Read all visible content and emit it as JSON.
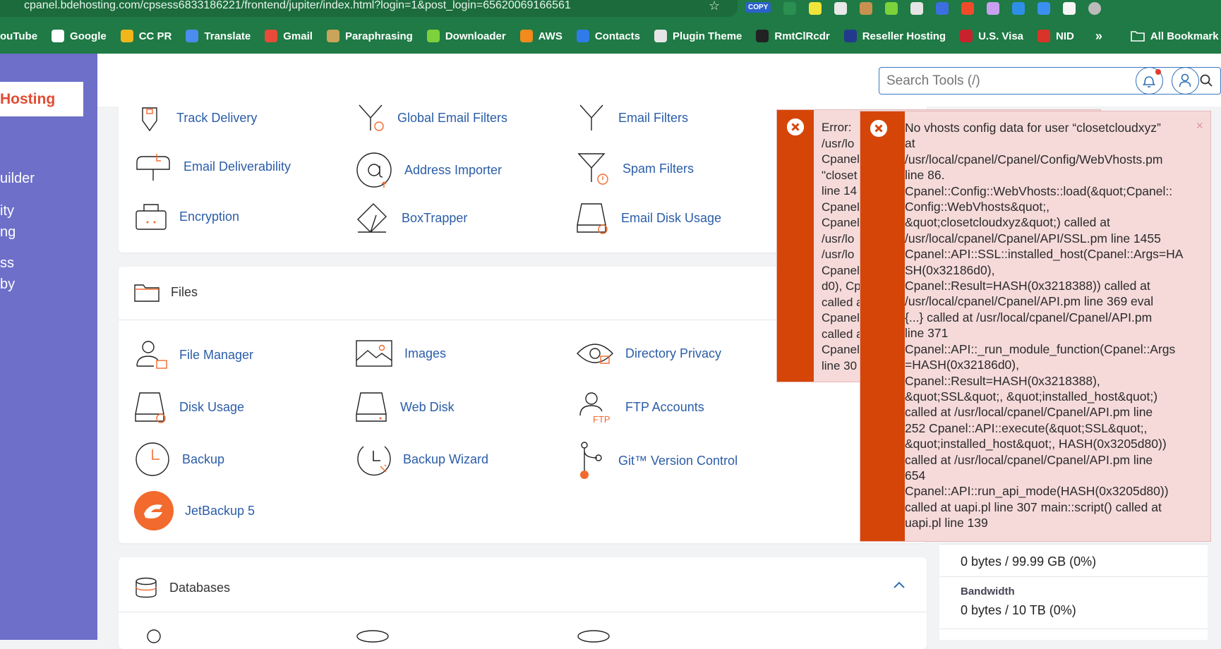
{
  "browser": {
    "url": "cpanel.bdehosting.com/cpsess6833186221/frontend/jupiter/index.html?login=1&post_login=65620069166561",
    "copy_badge": "COPY",
    "bookmarks": [
      {
        "label": "ouTube",
        "color": "#e62117"
      },
      {
        "label": "Google",
        "color": "#ffffff"
      },
      {
        "label": "CC PR",
        "color": "#f2b61b"
      },
      {
        "label": "Translate",
        "color": "#4a8cf0"
      },
      {
        "label": "Gmail",
        "color": "#e84b3a"
      },
      {
        "label": "Paraphrasing",
        "color": "#c9a45a"
      },
      {
        "label": "Downloader",
        "color": "#7dd23b"
      },
      {
        "label": "AWS",
        "color": "#f28a1c"
      },
      {
        "label": "Contacts",
        "color": "#2f7be8"
      },
      {
        "label": "Plugin Theme",
        "color": "#e5e5e5"
      },
      {
        "label": "RmtClRcdr",
        "color": "#222222"
      },
      {
        "label": "Reseller Hosting",
        "color": "#233a8c"
      },
      {
        "label": "U.S. Visa",
        "color": "#c8232c"
      },
      {
        "label": "NID",
        "color": "#d9342a"
      }
    ],
    "more_chevron": "»",
    "all_bookmarks": "All Bookmark"
  },
  "sidebar": {
    "logo_text": "Hosting",
    "items": [
      "uilder",
      "ity",
      "ng",
      "ss",
      "by"
    ]
  },
  "search": {
    "placeholder": "Search Tools (/)"
  },
  "email_tools": [
    "Track Delivery",
    "Global Email Filters",
    "Email Filters",
    "Email Deliverability",
    "Address Importer",
    "Spam Filters",
    "Encryption",
    "BoxTrapper",
    "Email Disk Usage"
  ],
  "files": {
    "title": "Files",
    "tools": [
      "File Manager",
      "Images",
      "Directory Privacy",
      "Disk Usage",
      "Web Disk",
      "FTP Accounts",
      "Backup",
      "Backup Wizard",
      "Git™ Version Control",
      "JetBackup 5"
    ]
  },
  "databases": {
    "title": "Databases"
  },
  "stats": [
    {
      "label": "",
      "value": "0 bytes / 99.99 GB   (0%)"
    },
    {
      "label": "Bandwidth",
      "value": "0 bytes / 10 TB   (0%)"
    }
  ],
  "errors": {
    "first": "Error:\n/usr/lo\nCpanel\n\"closet\nline 14\nCpanel\nCpanel\n/usr/lo\n/usr/lo\nCpanel\nd0), Cp\ncalled a\nCpanel\ncalled a\nCpanel\nline 30",
    "second": "No vhosts config data for user “closetcloudxyz”\nat\n/usr/local/cpanel/Cpanel/Config/WebVhosts.pm\nline 86.\nCpanel::Config::WebVhosts::load(&quot;Cpanel::\nConfig::WebVhosts&quot;,\n&quot;closetcloudxyz&quot;) called at\n/usr/local/cpanel/Cpanel/API/SSL.pm line 1455\nCpanel::API::SSL::installed_host(Cpanel::Args=HA\nSH(0x32186d0),\nCpanel::Result=HASH(0x3218388)) called at\n/usr/local/cpanel/Cpanel/API.pm line 369 eval\n{...} called at /usr/local/cpanel/Cpanel/API.pm\nline 371\nCpanel::API::_run_module_function(Cpanel::Args\n=HASH(0x32186d0),\nCpanel::Result=HASH(0x3218388),\n&quot;SSL&quot;, &quot;installed_host&quot;)\ncalled at /usr/local/cpanel/Cpanel/API.pm line\n252 Cpanel::API::execute(&quot;SSL&quot;,\n&quot;installed_host&quot;, HASH(0x3205d80))\ncalled at /usr/local/cpanel/Cpanel/API.pm line\n654\nCpanel::API::run_api_mode(HASH(0x3205d80))\ncalled at uapi.pl line 307 main::script() called at\nuapi.pl line 139",
    "close_glyph": "×"
  },
  "colors": {
    "accent_blue": "#2b5da8",
    "icon_orange": "#f26a2e",
    "error_bar": "#d64508",
    "sidebar": "#6d6fc9"
  }
}
